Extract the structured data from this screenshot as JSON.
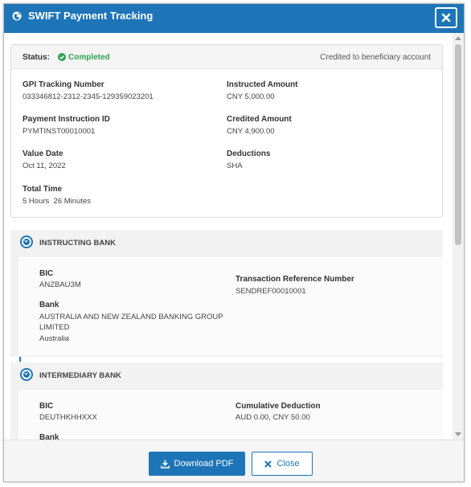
{
  "dialog": {
    "title": "SWIFT Payment Tracking",
    "close_icon": "close-icon",
    "title_icon": "globe-icon"
  },
  "status": {
    "label": "Status:",
    "value": "Completed",
    "value_color": "#2ea44f",
    "description": "Credited to beneficiary account"
  },
  "details": {
    "gpi_label": "GPI Tracking Number",
    "gpi_value": "033346812-2312-2345-129359023201",
    "instructed_label": "Instructed Amount",
    "instructed_value": "CNY 5,000.00",
    "payment_id_label": "Payment Instruction ID",
    "payment_id_value": "PYMTINST00010001",
    "credited_label": "Credited Amount",
    "credited_value": "CNY 4,900.00",
    "value_date_label": "Value Date",
    "value_date_value": "Oct 11, 2022",
    "deductions_label": "Deductions",
    "deductions_value": "SHA",
    "total_time_label": "Total Time",
    "total_time_value": "5 Hours  26 Minutes"
  },
  "instructing_bank": {
    "title": "INSTRUCTING BANK",
    "bic_label": "BIC",
    "bic_value": "ANZBAU3M",
    "bank_label": "Bank",
    "bank_name_line1": "AUSTRALIA AND NEW ZEALAND BANKING GROUP",
    "bank_name_line2": "LIMITED",
    "bank_country": "Australia",
    "ref_label": "Transaction Reference Number",
    "ref_value": "SENDREF00010001"
  },
  "intermediary_bank": {
    "title": "INTERMEDIARY BANK",
    "bic_label": "BIC",
    "bic_value": "DEUTHKHHXXX",
    "bank_label": "Bank",
    "cumulative_label": "Cumulative Deduction",
    "cumulative_value": "AUD 0.00, CNY 50.00"
  },
  "footer": {
    "download_label": "Download PDF",
    "close_label": "Close"
  },
  "colors": {
    "accent": "#1d75b8",
    "success": "#2ea44f"
  }
}
